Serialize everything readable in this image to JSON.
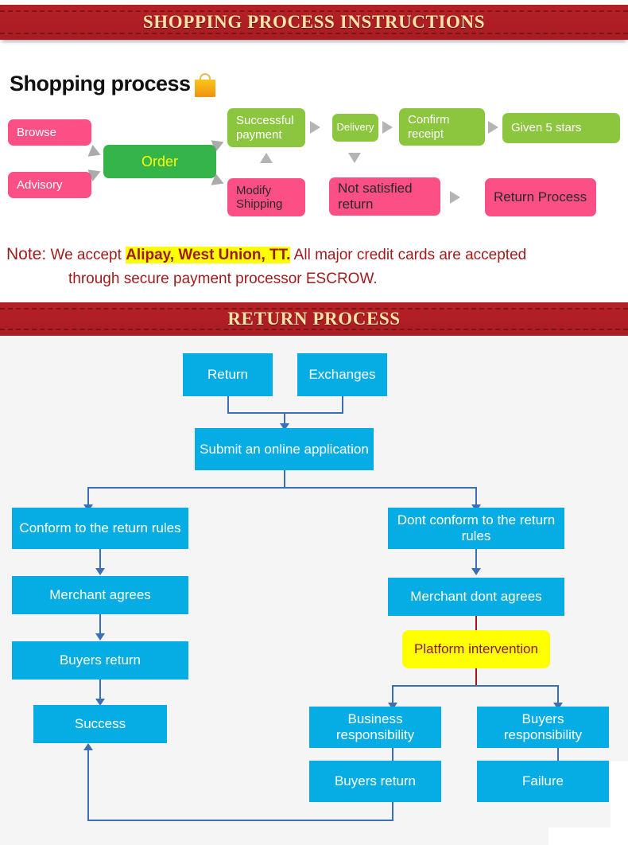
{
  "banners": {
    "top": "SHOPPING PROCESS INSTRUCTIONS",
    "return": "RETURN PROCESS"
  },
  "shopping_heading": "Shopping process",
  "shopping_flow": {
    "browse": "Browse",
    "advisory": "Advisory",
    "order": "Order",
    "successful_payment": "Successful payment",
    "delivery": "Delivery",
    "confirm_receipt": "Confirm receipt",
    "given_5_stars": "Given 5 stars",
    "modify_shipping": "Modify Shipping",
    "not_satisfied_return": "Not satisfied return",
    "return_process": "Return Process"
  },
  "note": {
    "label": "Note:",
    "line1_pre": "We accept ",
    "line1_highlight": "Alipay, West Union, TT.",
    "line1_post": " All major credit cards are accepted",
    "line2": "through secure payment processor ESCROW."
  },
  "return_flow": {
    "return": "Return",
    "exchanges": "Exchanges",
    "submit": "Submit an online application",
    "conform": "Conform to the return rules",
    "not_conform": "Dont conform to the return rules",
    "merchant_agrees": "Merchant agrees",
    "merchant_dont_agrees": "Merchant dont agrees",
    "buyers_return_left": "Buyers return",
    "platform_intervention": "Platform intervention",
    "success": "Success",
    "business_responsibility": "Business responsibility",
    "buyers_responsibility": "Buyers responsibility",
    "buyers_return_right": "Buyers return",
    "failure": "Failure"
  },
  "colors": {
    "banner_red": "#b01f24",
    "banner_gold": "#f7e2a8",
    "pink": "#fb4f85",
    "green": "#35b44a",
    "light_green": "#8cc63f",
    "blue": "#06ade4",
    "yellow": "#ffff00",
    "note_red": "#9e1b1b",
    "connector_blue": "#3b6fb6"
  }
}
